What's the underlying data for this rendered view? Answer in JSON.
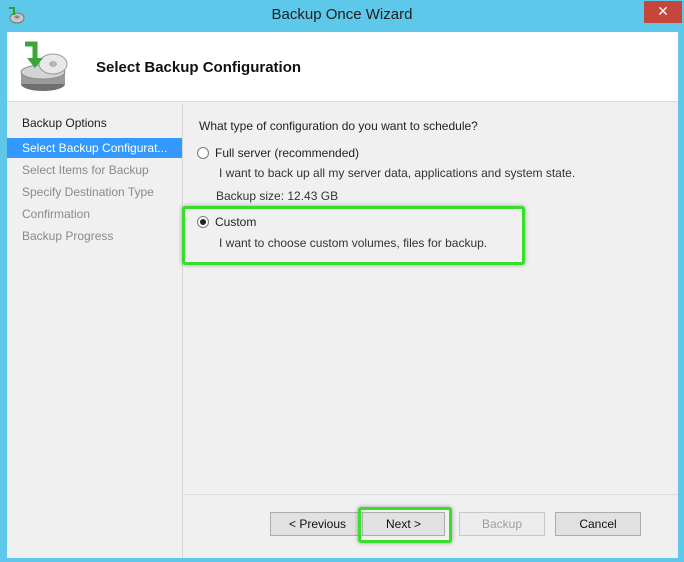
{
  "window": {
    "title": "Backup Once Wizard",
    "close_glyph": "✕",
    "app_icon": "backup-app-icon"
  },
  "header": {
    "title": "Select Backup Configuration",
    "icon": "backup-drive-icon"
  },
  "nav": {
    "items": [
      {
        "label": "Backup Options",
        "state": "completed"
      },
      {
        "label": "Select Backup Configurat...",
        "state": "selected"
      },
      {
        "label": "Select Items for Backup",
        "state": "pending"
      },
      {
        "label": "Specify Destination Type",
        "state": "pending"
      },
      {
        "label": "Confirmation",
        "state": "pending"
      },
      {
        "label": "Backup Progress",
        "state": "pending"
      }
    ]
  },
  "main": {
    "question": "What type of configuration do you want to schedule?",
    "options": [
      {
        "label": "Full server (recommended)",
        "desc": "I want to back up all my server data, applications and system state.",
        "extra": "Backup size: 12.43 GB",
        "selected": false
      },
      {
        "label": "Custom",
        "desc": "I want to choose custom volumes, files for backup.",
        "selected": true
      }
    ]
  },
  "buttons": {
    "previous": "< Previous",
    "next": "Next >",
    "backup": "Backup",
    "cancel": "Cancel"
  },
  "colors": {
    "titlebar": "#5ec8ea",
    "nav_selected": "#3399ff",
    "highlight": "#36e02a",
    "close": "#c7463b"
  }
}
